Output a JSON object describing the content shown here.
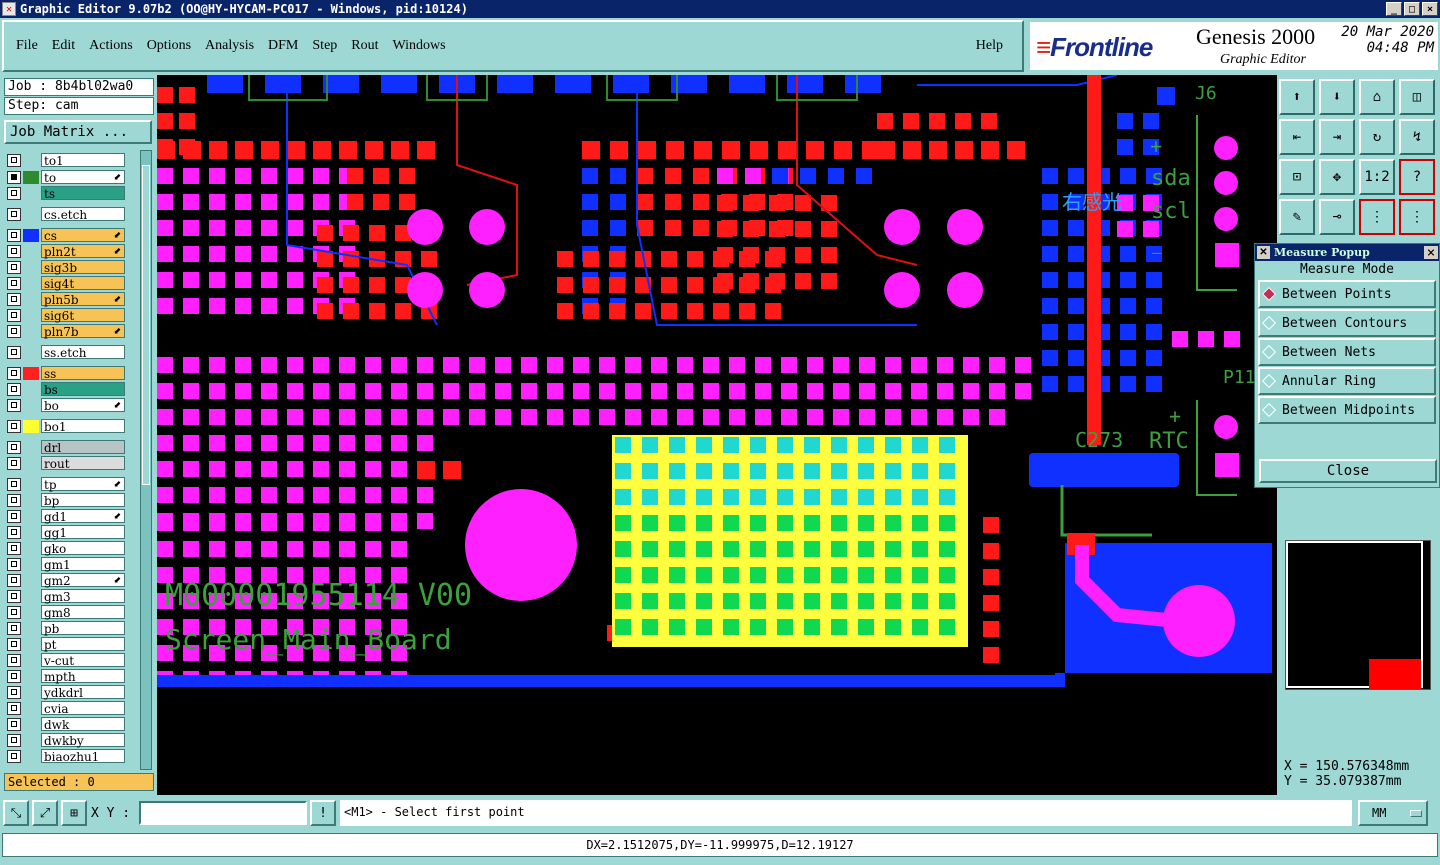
{
  "window": {
    "title": "Graphic Editor 9.07b2 (OO@HY-HYCAM-PC017 - Windows, pid:10124)"
  },
  "menu": [
    "File",
    "Edit",
    "Actions",
    "Options",
    "Analysis",
    "DFM",
    "Step",
    "Rout",
    "Windows"
  ],
  "help_label": "Help",
  "brand": {
    "logo": "Frontline",
    "product": "Genesis 2000",
    "subtitle": "Graphic Editor",
    "date": "20 Mar 2020",
    "time": "04:48 PM"
  },
  "job": {
    "job_label": "Job : 8b4bl02wa0",
    "step_label": "Step: cam",
    "matrix_button": "Job Matrix ..."
  },
  "layers": [
    {
      "name": "to1",
      "color": "#ffffff",
      "swatch": ""
    },
    {
      "name": "to",
      "color": "#ffffff",
      "swatch": "#2f8a2f",
      "active": true,
      "editable": true
    },
    {
      "name": "ts",
      "color": "#2aa085",
      "swatch": ""
    },
    {
      "name": "cs.etch",
      "color": "#ffffff",
      "swatch": ""
    },
    {
      "name": "cs",
      "color": "#f7c356",
      "swatch": "#1030ff",
      "editable": true
    },
    {
      "name": "pln2t",
      "color": "#f7c356",
      "swatch": "",
      "editable": true
    },
    {
      "name": "sig3b",
      "color": "#f7c356",
      "swatch": ""
    },
    {
      "name": "sig4t",
      "color": "#f7c356",
      "swatch": ""
    },
    {
      "name": "pln5b",
      "color": "#f7c356",
      "swatch": "",
      "editable": true
    },
    {
      "name": "sig6t",
      "color": "#f7c356",
      "swatch": ""
    },
    {
      "name": "pln7b",
      "color": "#f7c356",
      "swatch": "",
      "editable": true
    },
    {
      "name": "ss.etch",
      "color": "#ffffff",
      "swatch": ""
    },
    {
      "name": "ss",
      "color": "#f7c356",
      "swatch": "#ff2020"
    },
    {
      "name": "bs",
      "color": "#2aa085",
      "swatch": ""
    },
    {
      "name": "bo",
      "color": "#ffffff",
      "swatch": "",
      "editable": true
    },
    {
      "name": "bo1",
      "color": "#ffffff",
      "swatch": "#ffff30"
    },
    {
      "name": "drl",
      "color": "#b8c4c4",
      "swatch": ""
    },
    {
      "name": "rout",
      "color": "#dcdcdc",
      "swatch": ""
    },
    {
      "name": "tp",
      "color": "#ffffff",
      "swatch": "",
      "editable": true
    },
    {
      "name": "bp",
      "color": "#ffffff",
      "swatch": ""
    },
    {
      "name": "gd1",
      "color": "#ffffff",
      "swatch": "",
      "editable": true
    },
    {
      "name": "gg1",
      "color": "#ffffff",
      "swatch": ""
    },
    {
      "name": "gko",
      "color": "#ffffff",
      "swatch": ""
    },
    {
      "name": "gm1",
      "color": "#ffffff",
      "swatch": ""
    },
    {
      "name": "gm2",
      "color": "#ffffff",
      "swatch": "",
      "editable": true
    },
    {
      "name": "gm3",
      "color": "#ffffff",
      "swatch": ""
    },
    {
      "name": "gm8",
      "color": "#ffffff",
      "swatch": ""
    },
    {
      "name": "pb",
      "color": "#ffffff",
      "swatch": ""
    },
    {
      "name": "pt",
      "color": "#ffffff",
      "swatch": ""
    },
    {
      "name": "v-cut",
      "color": "#ffffff",
      "swatch": ""
    },
    {
      "name": "mpth",
      "color": "#ffffff",
      "swatch": ""
    },
    {
      "name": "ydkdrl",
      "color": "#ffffff",
      "swatch": ""
    },
    {
      "name": "cvia",
      "color": "#ffffff",
      "swatch": ""
    },
    {
      "name": "dwk",
      "color": "#ffffff",
      "swatch": ""
    },
    {
      "name": "dwkby",
      "color": "#ffffff",
      "swatch": ""
    },
    {
      "name": "biaozhu1",
      "color": "#ffffff",
      "swatch": ""
    }
  ],
  "selected_label": "Selected : 0",
  "canvas_text": {
    "part_number": "M000001955114 V00",
    "board_name": "Screen_Main_Board",
    "j6": "J6",
    "sda": "sda",
    "scl": "scl",
    "chinese": "右感光",
    "p11": "P11",
    "c273": "C273",
    "rtc": "RTC",
    "plus1": "+",
    "plus2": "+",
    "minus": "—"
  },
  "measure_popup": {
    "title": "Measure Popup",
    "mode_label": "Measure Mode",
    "options": [
      "Between Points",
      "Between Contours",
      "Between Nets",
      "Annular Ring",
      "Between Midpoints"
    ],
    "selected_option": "Between Points",
    "close_label": "Close"
  },
  "coords": {
    "x": "X = 150.576348mm",
    "y": "Y = 35.079387mm"
  },
  "bottom": {
    "xy_label": "X Y :",
    "xy_value": "",
    "message": "<M1> - Select first point",
    "units": "MM",
    "status": "DX=2.1512075,DY=-11.999975,D=12.19127"
  },
  "colors": {
    "panel": "#9dd8d4",
    "magenta": "#ff20ff",
    "red": "#ff1a1a",
    "blue": "#1030ff",
    "green": "#2f8a2f",
    "yellow": "#ffff40",
    "cyan": "#20d8d0",
    "silk": "#3ca03c"
  }
}
